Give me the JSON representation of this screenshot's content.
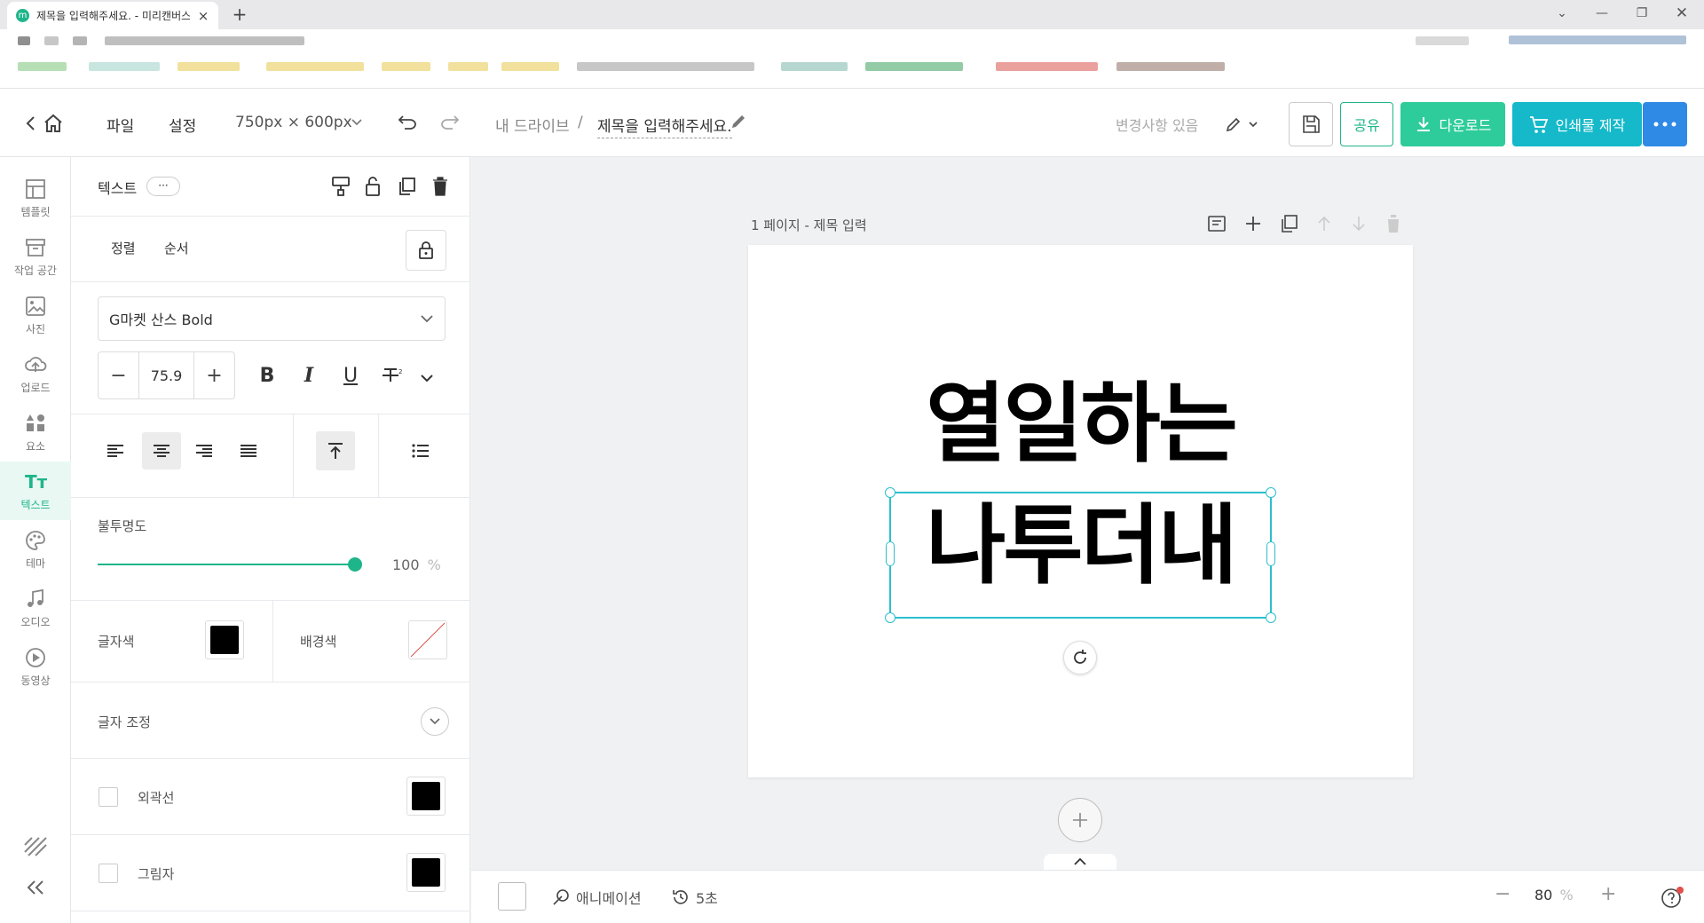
{
  "browser": {
    "tab_title": "제목을 입력해주세요. - 미리캔버스",
    "favicon_letter": "m",
    "tab_close": "×",
    "new_tab": "+"
  },
  "header": {
    "file_menu": "파일",
    "settings_menu": "설정",
    "canvas_size": "750px × 600px",
    "drive_link": "내 드라이브",
    "breadcrumb_sep": "/",
    "doc_title": "제목을 입력해주세요.",
    "save_status": "변경사항 있음",
    "share_label": "공유",
    "download_label": "다운로드",
    "print_label": "인쇄물 제작",
    "accent_color": "#1fb58a",
    "download_color": "#2ecc9a",
    "print_color": "#15b9c9",
    "more_color": "#2f8ae6"
  },
  "rail": {
    "items": [
      {
        "label": "템플릿",
        "icon": "template-icon"
      },
      {
        "label": "작업 공간",
        "icon": "workspace-icon"
      },
      {
        "label": "사진",
        "icon": "photo-icon"
      },
      {
        "label": "업로드",
        "icon": "upload-icon"
      },
      {
        "label": "요소",
        "icon": "elements-icon"
      },
      {
        "label": "텍스트",
        "icon": "text-icon",
        "active": true
      },
      {
        "label": "테마",
        "icon": "palette-icon"
      },
      {
        "label": "오디오",
        "icon": "music-icon"
      },
      {
        "label": "동영상",
        "icon": "video-icon"
      }
    ]
  },
  "panel": {
    "title": "텍스트",
    "more": "···",
    "align_tab": "정렬",
    "order_tab": "순서",
    "font_name": "G마켓 산스 Bold",
    "font_size": "75.9",
    "minus": "−",
    "plus": "+",
    "bold": "B",
    "italic": "I",
    "underline": "U",
    "opacity_label": "불투명도",
    "opacity_value": "100",
    "opacity_unit": "%",
    "opacity_fraction": 1.0,
    "text_color_label": "글자색",
    "text_color": "#000000",
    "bg_color_label": "배경색",
    "letter_adjust_label": "글자 조정",
    "outline_label": "외곽선",
    "shadow_label": "그림자"
  },
  "canvas": {
    "page_label": "1 페이지 - 제목 입력",
    "line1": "열일하는",
    "line2": "나투더내",
    "selection_color": "#2bbfcf"
  },
  "footer": {
    "animation_label": "애니메이션",
    "duration_label": "5초",
    "zoom_value": "80",
    "zoom_unit": "%",
    "zoom_minus": "−",
    "zoom_plus": "+"
  }
}
